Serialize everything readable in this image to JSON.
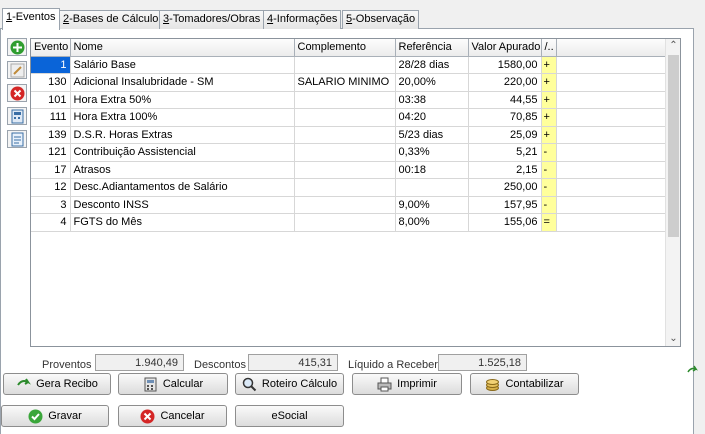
{
  "tabs": [
    {
      "key": "1",
      "label": "-Eventos"
    },
    {
      "key": "2",
      "label": "-Bases de Cálculo"
    },
    {
      "key": "3",
      "label": "-Tomadores/Obras"
    },
    {
      "key": "4",
      "label": "-Informações"
    },
    {
      "key": "5",
      "label": "-Observação"
    }
  ],
  "side_tools": [
    "add-icon",
    "edit-icon",
    "delete-icon",
    "calculator-icon",
    "notes-icon"
  ],
  "grid": {
    "headers": {
      "evento": "Evento",
      "nome": "Nome",
      "complemento": "Complemento",
      "referencia": "Referência",
      "valor": "Valor Apurado",
      "sign": "/.."
    },
    "rows": [
      {
        "evento": "1",
        "nome": "Salário Base",
        "complemento": "",
        "referencia": "28/28 dias",
        "valor": "1580,00",
        "sign": "+"
      },
      {
        "evento": "130",
        "nome": "Adicional Insalubridade - SM",
        "complemento": "SALARIO MINIMO",
        "referencia": "20,00%",
        "valor": "220,00",
        "sign": "+"
      },
      {
        "evento": "101",
        "nome": "Hora Extra 50%",
        "complemento": "",
        "referencia": "03:38",
        "valor": "44,55",
        "sign": "+"
      },
      {
        "evento": "111",
        "nome": "Hora Extra 100%",
        "complemento": "",
        "referencia": "04:20",
        "valor": "70,85",
        "sign": "+"
      },
      {
        "evento": "139",
        "nome": "D.S.R. Horas Extras",
        "complemento": "",
        "referencia": "5/23 dias",
        "valor": "25,09",
        "sign": "+"
      },
      {
        "evento": "121",
        "nome": "Contribuição Assistencial",
        "complemento": "",
        "referencia": "0,33%",
        "valor": "5,21",
        "sign": "-"
      },
      {
        "evento": "17",
        "nome": "Atrasos",
        "complemento": "",
        "referencia": "00:18",
        "valor": "2,15",
        "sign": "-"
      },
      {
        "evento": "12",
        "nome": "Desc.Adiantamentos de Salário",
        "complemento": "",
        "referencia": "",
        "valor": "250,00",
        "sign": "-"
      },
      {
        "evento": "3",
        "nome": "Desconto INSS",
        "complemento": "",
        "referencia": "9,00%",
        "valor": "157,95",
        "sign": "-"
      },
      {
        "evento": "4",
        "nome": "FGTS do Mês",
        "complemento": "",
        "referencia": "8,00%",
        "valor": "155,06",
        "sign": "="
      }
    ]
  },
  "totals": {
    "proventos_label": "Proventos",
    "proventos": "1.940,49",
    "descontos_label": "Descontos",
    "descontos": "415,31",
    "liquido_label": "Líquido a Receber",
    "liquido": "1.525,18"
  },
  "buttons": {
    "gera_recibo": "Gera Recibo",
    "calcular": "Calcular",
    "roteiro": "Roteiro Cálculo",
    "imprimir": "Imprimir",
    "contabilizar": "Contabilizar",
    "gravar": "Gravar",
    "cancelar": "Cancelar",
    "esocial": "eSocial"
  },
  "colors": {
    "selection": "#0a64d8",
    "sign_cell": "#ffff9c"
  }
}
